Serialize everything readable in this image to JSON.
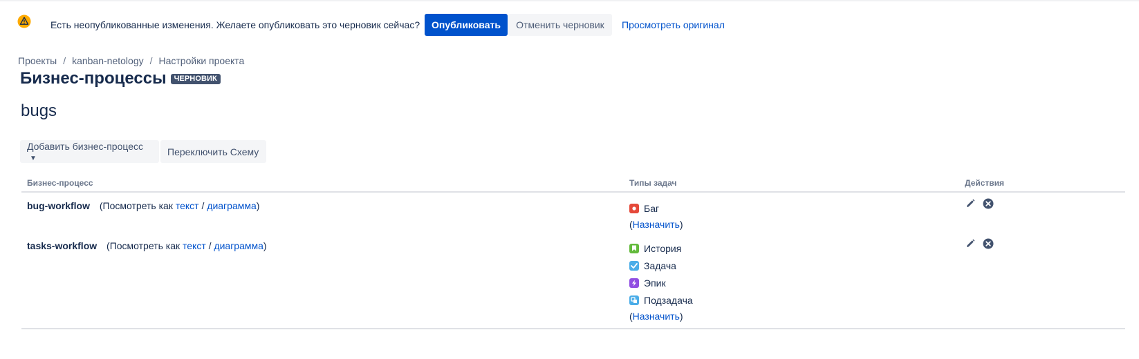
{
  "banner": {
    "message": "Есть неопубликованные изменения. Желаете опубликовать это черновик сейчас?",
    "publish_label": "Опубликовать",
    "discard_label": "Отменить черновик",
    "view_original_label": "Просмотреть оригинал"
  },
  "breadcrumb": {
    "items": [
      "Проекты",
      "kanban-netology",
      "Настройки проекта"
    ],
    "separator": "/"
  },
  "page": {
    "title": "Бизнес-процессы",
    "status_lozenge": "ЧЕРНОВИК",
    "scheme_name": "bugs"
  },
  "toolbar": {
    "add_workflow_label": "Добавить бизнес-процесс",
    "switch_scheme_label": "Переключить Схему"
  },
  "table": {
    "headers": {
      "workflow": "Бизнес-процесс",
      "issue_types": "Типы задач",
      "actions": "Действия"
    },
    "view_prefix": "(Посмотреть как",
    "view_text": "текст",
    "view_slash": "/",
    "view_diagram": "диаграмма",
    "view_suffix": ")",
    "assign_open": "(",
    "assign_label": "Назначить",
    "assign_close": ")",
    "rows": [
      {
        "name": "bug-workflow",
        "issue_types": [
          {
            "label": "Баг",
            "icon": "bug-icon",
            "color": "#e5493a"
          }
        ]
      },
      {
        "name": "tasks-workflow",
        "issue_types": [
          {
            "label": "История",
            "icon": "story-icon",
            "color": "#63ba3c"
          },
          {
            "label": "Задача",
            "icon": "task-icon",
            "color": "#4bade8"
          },
          {
            "label": "Эпик",
            "icon": "epic-icon",
            "color": "#904ee2"
          },
          {
            "label": "Подзадача",
            "icon": "subtask-icon",
            "color": "#4bade8"
          }
        ]
      }
    ]
  },
  "colors": {
    "primary": "#0052cc",
    "text": "#172b4d",
    "warning": "#ffab00",
    "lozenge": "#42526e"
  }
}
